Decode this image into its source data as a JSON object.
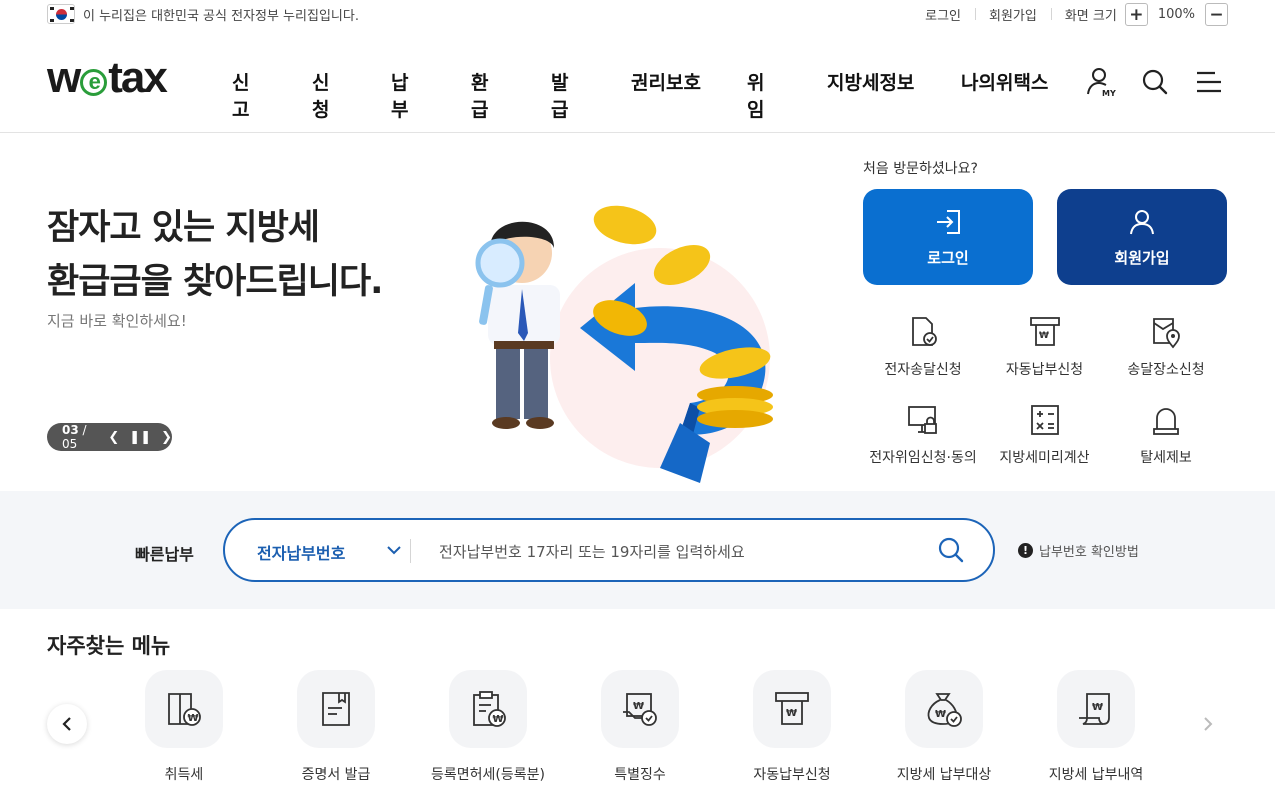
{
  "topbar": {
    "gov_notice": "이 누리집은 대한민국 공식 전자정부 누리집입니다.",
    "login": "로그인",
    "signup": "회원가입",
    "zoom_label": "화면 크기",
    "zoom_in": "+",
    "zoom_value": "100%",
    "zoom_out": "−"
  },
  "gnb": {
    "logo": {
      "pre": "w",
      "mid": "e",
      "post": "tax"
    },
    "menu": [
      "신고",
      "신청",
      "납부",
      "환급",
      "발급",
      "권리보호",
      "위임",
      "지방세정보",
      "나의위택스"
    ],
    "my_badge": "MY"
  },
  "hero": {
    "headline_line1": "잠자고 있는 지방세",
    "headline_line2": "환급금을 찾아드립니다.",
    "subtext": "지금 바로 확인하세요!",
    "slide_current": "03",
    "slide_separator": "/",
    "slide_total": "05"
  },
  "member": {
    "question": "처음 방문하셨나요?",
    "login_label": "로그인",
    "join_label": "회원가입"
  },
  "quick_services": [
    {
      "label": "전자송달신청",
      "icon": "document-check-icon"
    },
    {
      "label": "자동납부신청",
      "icon": "auto-payment-icon"
    },
    {
      "label": "송달장소신청",
      "icon": "location-doc-icon"
    },
    {
      "label": "전자위임신청·동의",
      "icon": "monitor-lock-icon"
    },
    {
      "label": "지방세미리계산",
      "icon": "calculator-icon"
    },
    {
      "label": "탈세제보",
      "icon": "siren-icon"
    }
  ],
  "quick_pay": {
    "label": "빠른납부",
    "selected": "전자납부번호",
    "placeholder": "전자납부번호 17자리 또는 19자리를 입력하세요",
    "howto": "납부번호 확인방법"
  },
  "frequent": {
    "title": "자주찾는 메뉴",
    "items": [
      {
        "label": "취득세",
        "icon": "acquisition-tax-icon"
      },
      {
        "label": "증명서 발급",
        "icon": "certificate-icon"
      },
      {
        "label": "등록면허세(등록분)",
        "icon": "registration-tax-icon"
      },
      {
        "label": "특별징수",
        "icon": "special-collection-icon"
      },
      {
        "label": "자동납부신청",
        "icon": "auto-payment-icon"
      },
      {
        "label": "지방세 납부대상",
        "icon": "money-bag-icon"
      },
      {
        "label": "지방세 납부내역",
        "icon": "receipt-scroll-icon"
      }
    ]
  },
  "colors": {
    "brand_blue": "#0a6fd0",
    "navy": "#0e3f8e",
    "logo_green": "#2a9d3a",
    "search_border": "#1c64b8"
  }
}
